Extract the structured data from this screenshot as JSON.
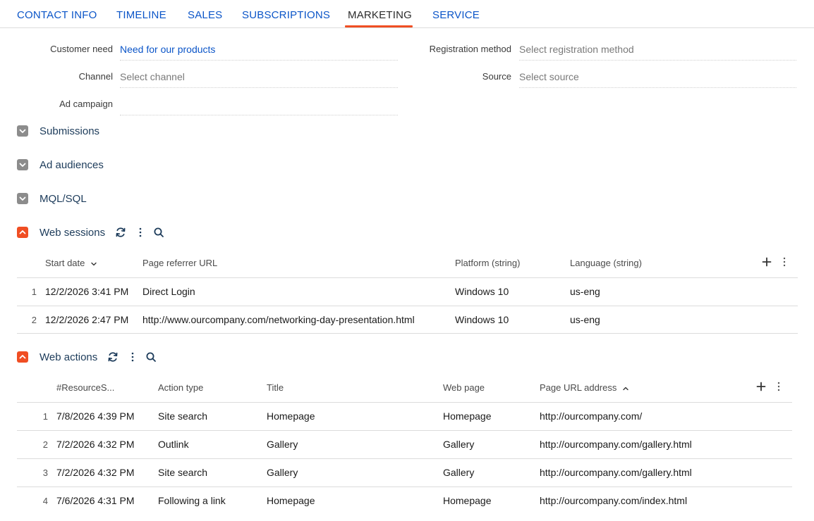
{
  "tabs": [
    {
      "label": "CONTACT INFO",
      "active": false
    },
    {
      "label": "TIMELINE",
      "active": false
    },
    {
      "label": "SALES",
      "active": false
    },
    {
      "label": "SUBSCRIPTIONS",
      "active": false
    },
    {
      "label": "MARKETING",
      "active": true
    },
    {
      "label": "SERVICE",
      "active": false
    }
  ],
  "fields": {
    "customer_need": {
      "label": "Customer need",
      "value": "Need for our products"
    },
    "channel": {
      "label": "Channel",
      "placeholder": "Select channel"
    },
    "ad_campaign": {
      "label": "Ad campaign",
      "value": ""
    },
    "registration_method": {
      "label": "Registration method",
      "placeholder": "Select registration method"
    },
    "source": {
      "label": "Source",
      "placeholder": "Select source"
    }
  },
  "groups": {
    "submissions": {
      "title": "Submissions",
      "expanded": false
    },
    "ad_audiences": {
      "title": "Ad audiences",
      "expanded": false
    },
    "mql_sql": {
      "title": "MQL/SQL",
      "expanded": false
    }
  },
  "web_sessions": {
    "title": "Web sessions",
    "columns": [
      "Start date",
      "Page referrer URL",
      "Platform (string)",
      "Language (string)"
    ],
    "sort": {
      "column": "Start date",
      "direction": "desc"
    },
    "rows": [
      {
        "num": "1",
        "start_date": "12/2/2026 3:41 PM",
        "referrer": "Direct Login",
        "platform": "Windows 10",
        "language": "us-eng"
      },
      {
        "num": "2",
        "start_date": "12/2/2026 2:47 PM",
        "referrer": "http://www.ourcompany.com/networking-day-presentation.html",
        "platform": "Windows 10",
        "language": "us-eng"
      }
    ]
  },
  "web_actions": {
    "title": "Web actions",
    "columns": [
      "#ResourceS...",
      "Action type",
      "Title",
      "Web page",
      "Page URL address"
    ],
    "sort": {
      "column": "Page URL address",
      "direction": "asc"
    },
    "rows": [
      {
        "num": "1",
        "resource": "7/8/2026 4:39 PM",
        "action_type": "Site search",
        "title": "Homepage",
        "web_page": "Homepage",
        "url": "http://ourcompany.com/"
      },
      {
        "num": "2",
        "resource": "7/2/2026 4:32 PM",
        "action_type": "Outlink",
        "title": "Gallery",
        "web_page": "Gallery",
        "url": "http://ourcompany.com/gallery.html"
      },
      {
        "num": "3",
        "resource": "7/2/2026 4:32 PM",
        "action_type": "Site search",
        "title": "Gallery",
        "web_page": "Gallery",
        "url": "http://ourcompany.com/gallery.html"
      },
      {
        "num": "4",
        "resource": "7/6/2026 4:31 PM",
        "action_type": "Following a link",
        "title": "Homepage",
        "web_page": "Homepage",
        "url": "http://ourcompany.com/index.html"
      }
    ]
  },
  "icons": {
    "collapse": "chevron-down-icon",
    "expand": "chevron-up-icon",
    "refresh": "refresh-icon",
    "more": "kebab-menu-icon",
    "search": "search-icon",
    "add": "plus-icon"
  },
  "colors": {
    "accent": "#f04e23",
    "link": "#0b55c8",
    "group_title": "#1c3b5a",
    "collapsed_caret": "#8c8c8c"
  }
}
